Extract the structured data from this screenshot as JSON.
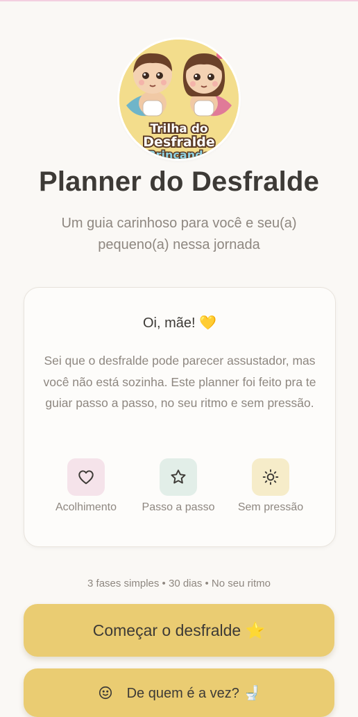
{
  "header": {
    "logo_text": [
      "Trilha do",
      "Desfralde",
      "Brincando"
    ],
    "title": "Planner do Desfralde",
    "subtitle": "Um guia carinhoso para você e seu(a) pequeno(a) nessa jornada"
  },
  "card": {
    "greeting": "Oi, mãe! 💛",
    "text": "Sei que o desfralde pode parecer assustador, mas você não está sozinha. Este planner foi feito pra te guiar passo a passo, no seu ritmo e sem pressão.",
    "features": [
      {
        "icon": "heart-icon",
        "label": "Acolhimento",
        "color": "#f5e3ea"
      },
      {
        "icon": "star-icon",
        "label": "Passo a passo",
        "color": "#e2eee8"
      },
      {
        "icon": "sun-icon",
        "label": "Sem pressão",
        "color": "#f6ecc9"
      }
    ]
  },
  "meta": "3 fases simples • 30 dias • No seu ritmo",
  "buttons": {
    "start_label": "Começar o desfralde ⭐",
    "turn_label": "De quem é a vez? 🚽"
  },
  "colors": {
    "background": "#faf8f5",
    "button": "#eacc72",
    "text": "#3d3a36",
    "muted": "#8e8780"
  }
}
